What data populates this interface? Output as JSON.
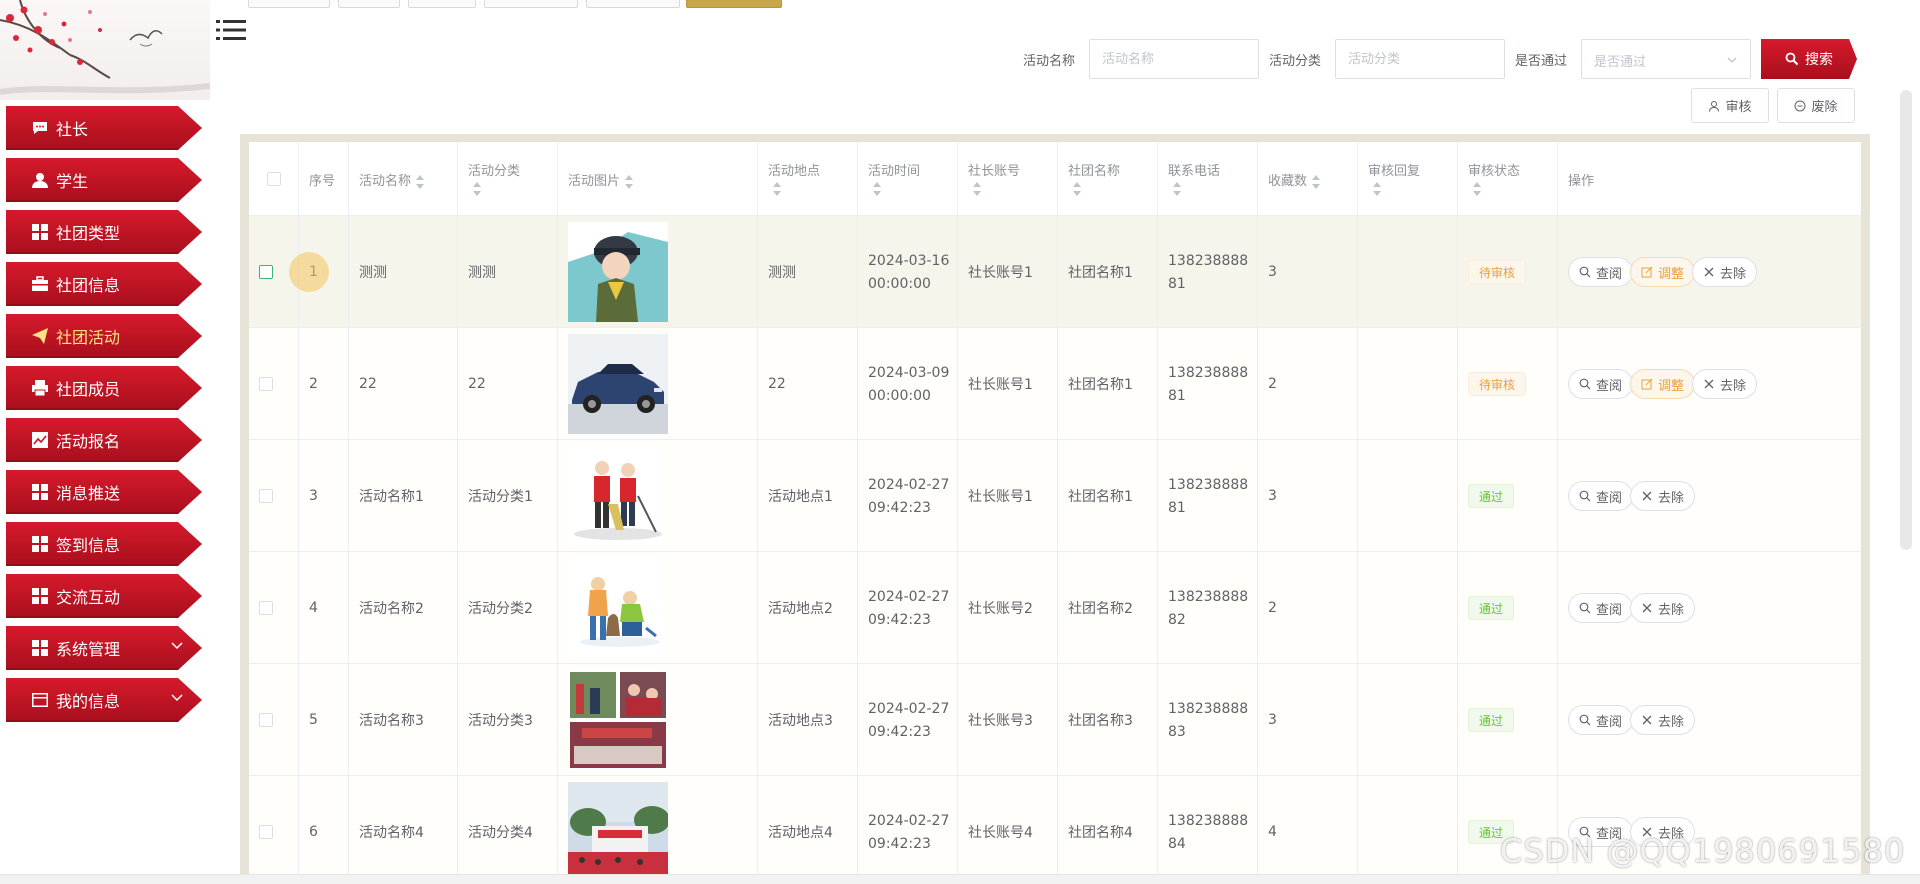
{
  "sidebar": {
    "items": [
      {
        "label": "社长",
        "icon": "chat-icon"
      },
      {
        "label": "学生",
        "icon": "user-icon"
      },
      {
        "label": "社团类型",
        "icon": "grid-icon"
      },
      {
        "label": "社团信息",
        "icon": "briefcase-icon"
      },
      {
        "label": "社团活动",
        "icon": "paper-plane-icon",
        "active": true
      },
      {
        "label": "社团成员",
        "icon": "printer-icon"
      },
      {
        "label": "活动报名",
        "icon": "chart-icon"
      },
      {
        "label": "消息推送",
        "icon": "grid-icon"
      },
      {
        "label": "签到信息",
        "icon": "grid-icon"
      },
      {
        "label": "交流互动",
        "icon": "grid-icon"
      },
      {
        "label": "系统管理",
        "icon": "grid-icon",
        "expandable": true
      },
      {
        "label": "我的信息",
        "icon": "wallet-icon",
        "expandable": true
      }
    ],
    "accent_color": "#c8121f",
    "active_text_color": "#ffe083"
  },
  "search": {
    "name_label": "活动名称",
    "name_placeholder": "活动名称",
    "category_label": "活动分类",
    "category_placeholder": "活动分类",
    "approved_label": "是否通过",
    "approved_placeholder": "是否通过",
    "search_button": "搜索"
  },
  "toolbar": {
    "review_button": "审核",
    "discard_button": "废除"
  },
  "table": {
    "columns": [
      "序号",
      "活动名称",
      "活动分类",
      "活动图片",
      "活动地点",
      "活动时间",
      "社长账号",
      "社团名称",
      "联系电话",
      "收藏数",
      "审核回复",
      "审核状态",
      "操作"
    ],
    "rows": [
      {
        "index": "1",
        "name": "测测",
        "category": "测测",
        "image": "cartoon-boy-cap-image",
        "place": "测测",
        "date": "2024-03-16",
        "time": "00:00:00",
        "account": "社长账号1",
        "club": "社团名称1",
        "phone1": "138238888",
        "phone2": "81",
        "favorites": "3",
        "reply": "",
        "status": "待审核",
        "status_type": "pending",
        "actions": [
          "查阅",
          "调整",
          "去除"
        ]
      },
      {
        "index": "2",
        "name": "22",
        "category": "22",
        "image": "blue-car-image",
        "place": "22",
        "date": "2024-03-09",
        "time": "00:00:00",
        "account": "社长账号1",
        "club": "社团名称1",
        "phone1": "138238888",
        "phone2": "81",
        "favorites": "2",
        "reply": "",
        "status": "待审核",
        "status_type": "pending",
        "actions": [
          "查阅",
          "调整",
          "去除"
        ]
      },
      {
        "index": "3",
        "name": "活动名称1",
        "category": "活动分类1",
        "image": "volunteers-cleaning-image",
        "place": "活动地点1",
        "date": "2024-02-27",
        "time": "09:42:23",
        "account": "社长账号1",
        "club": "社团名称1",
        "phone1": "138238888",
        "phone2": "81",
        "favorites": "3",
        "reply": "",
        "status": "通过",
        "status_type": "pass",
        "actions": [
          "查阅",
          "去除"
        ]
      },
      {
        "index": "4",
        "name": "活动名称2",
        "category": "活动分类2",
        "image": "volunteers-cartoon-image",
        "place": "活动地点2",
        "date": "2024-02-27",
        "time": "09:42:23",
        "account": "社长账号2",
        "club": "社团名称2",
        "phone1": "138238888",
        "phone2": "82",
        "favorites": "2",
        "reply": "",
        "status": "通过",
        "status_type": "pass",
        "actions": [
          "查阅",
          "去除"
        ]
      },
      {
        "index": "5",
        "name": "活动名称3",
        "category": "活动分类3",
        "image": "event-photo-collage-image",
        "place": "活动地点3",
        "date": "2024-02-27",
        "time": "09:42:23",
        "account": "社长账号3",
        "club": "社团名称3",
        "phone1": "138238888",
        "phone2": "83",
        "favorites": "3",
        "reply": "",
        "status": "通过",
        "status_type": "pass",
        "actions": [
          "查阅",
          "去除"
        ]
      },
      {
        "index": "6",
        "name": "活动名称4",
        "category": "活动分类4",
        "image": "outdoor-event-stage-image",
        "place": "活动地点4",
        "date": "2024-02-27",
        "time": "09:42:23",
        "account": "社长账号4",
        "club": "社团名称4",
        "phone1": "138238888",
        "phone2": "84",
        "favorites": "4",
        "reply": "",
        "status": "通过",
        "status_type": "pass",
        "actions": [
          "查阅",
          "去除"
        ]
      }
    ]
  },
  "watermark": "CSDN @QQ1980691580"
}
